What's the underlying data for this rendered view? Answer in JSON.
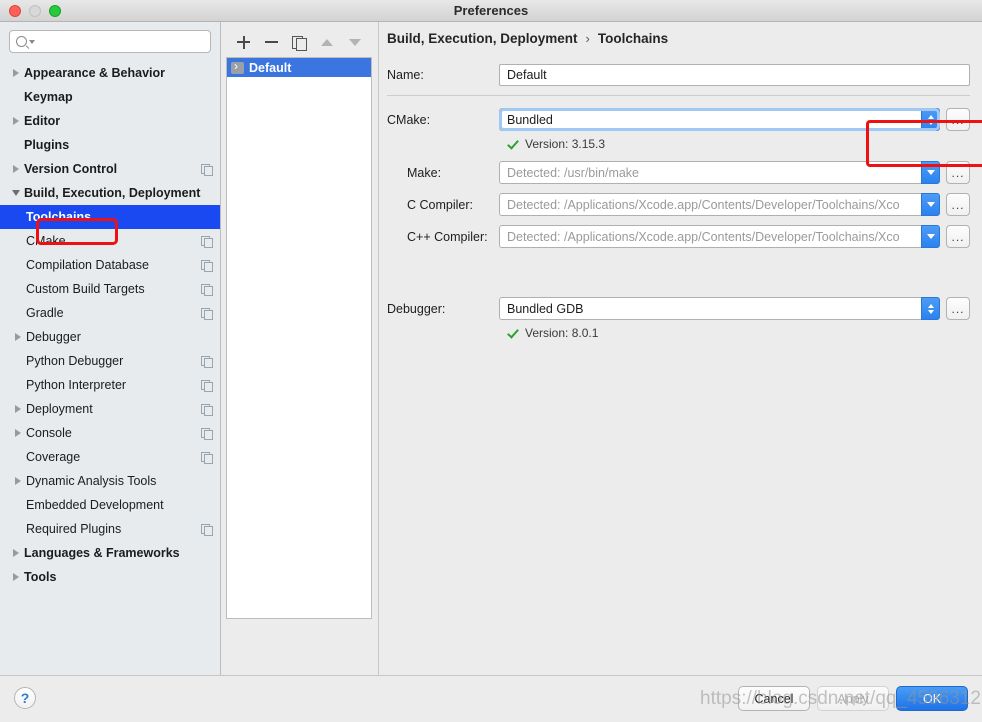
{
  "window": {
    "title": "Preferences",
    "traffic_lights": [
      "close-red",
      "minimize-gray",
      "zoom-green"
    ]
  },
  "sidebar": {
    "search": {
      "value": "",
      "placeholder": ""
    },
    "items": [
      {
        "label": "Appearance & Behavior",
        "level": 0,
        "twisty": "collapsed",
        "bold": true,
        "badge": false,
        "selected": false
      },
      {
        "label": "Keymap",
        "level": 0,
        "twisty": "none",
        "bold": true,
        "badge": false,
        "selected": false
      },
      {
        "label": "Editor",
        "level": 0,
        "twisty": "collapsed",
        "bold": true,
        "badge": false,
        "selected": false
      },
      {
        "label": "Plugins",
        "level": 0,
        "twisty": "none",
        "bold": true,
        "badge": false,
        "selected": false
      },
      {
        "label": "Version Control",
        "level": 0,
        "twisty": "collapsed",
        "bold": true,
        "badge": true,
        "selected": false
      },
      {
        "label": "Build, Execution, Deployment",
        "level": 0,
        "twisty": "expanded",
        "bold": true,
        "badge": false,
        "selected": false
      },
      {
        "label": "Toolchains",
        "level": 1,
        "twisty": "none",
        "bold": false,
        "badge": false,
        "selected": true
      },
      {
        "label": "CMake",
        "level": 1,
        "twisty": "none",
        "bold": false,
        "badge": true,
        "selected": false
      },
      {
        "label": "Compilation Database",
        "level": 1,
        "twisty": "none",
        "bold": false,
        "badge": true,
        "selected": false
      },
      {
        "label": "Custom Build Targets",
        "level": 1,
        "twisty": "none",
        "bold": false,
        "badge": true,
        "selected": false
      },
      {
        "label": "Gradle",
        "level": 1,
        "twisty": "none",
        "bold": false,
        "badge": true,
        "selected": false
      },
      {
        "label": "Debugger",
        "level": 1,
        "twisty": "collapsed",
        "bold": false,
        "badge": false,
        "selected": false
      },
      {
        "label": "Python Debugger",
        "level": 1,
        "twisty": "none",
        "bold": false,
        "badge": true,
        "selected": false
      },
      {
        "label": "Python Interpreter",
        "level": 1,
        "twisty": "none",
        "bold": false,
        "badge": true,
        "selected": false
      },
      {
        "label": "Deployment",
        "level": 1,
        "twisty": "collapsed",
        "bold": false,
        "badge": true,
        "selected": false
      },
      {
        "label": "Console",
        "level": 1,
        "twisty": "collapsed",
        "bold": false,
        "badge": true,
        "selected": false
      },
      {
        "label": "Coverage",
        "level": 1,
        "twisty": "none",
        "bold": false,
        "badge": true,
        "selected": false
      },
      {
        "label": "Dynamic Analysis Tools",
        "level": 1,
        "twisty": "collapsed",
        "bold": false,
        "badge": false,
        "selected": false
      },
      {
        "label": "Embedded Development",
        "level": 1,
        "twisty": "none",
        "bold": false,
        "badge": false,
        "selected": false
      },
      {
        "label": "Required Plugins",
        "level": 1,
        "twisty": "none",
        "bold": false,
        "badge": true,
        "selected": false
      },
      {
        "label": "Languages & Frameworks",
        "level": 0,
        "twisty": "collapsed",
        "bold": true,
        "badge": false,
        "selected": false
      },
      {
        "label": "Tools",
        "level": 0,
        "twisty": "collapsed",
        "bold": true,
        "badge": false,
        "selected": false
      }
    ]
  },
  "toolchain_list": {
    "toolbar": [
      {
        "icon": "plus-icon",
        "name": "add-toolchain-button",
        "enabled": true
      },
      {
        "icon": "minus-icon",
        "name": "remove-toolchain-button",
        "enabled": true
      },
      {
        "icon": "copy-icon",
        "name": "duplicate-toolchain-button",
        "enabled": true
      },
      {
        "icon": "arrow-up-icon",
        "name": "move-up-button",
        "enabled": false
      },
      {
        "icon": "arrow-down-icon",
        "name": "move-down-button",
        "enabled": false
      }
    ],
    "items": [
      {
        "label": "Default",
        "selected": true
      }
    ]
  },
  "breadcrumb": {
    "root": "Build, Execution, Deployment",
    "separator": "›",
    "leaf": "Toolchains"
  },
  "form": {
    "name": {
      "label": "Name:",
      "value": "Default"
    },
    "cmake": {
      "label": "CMake:",
      "value": "Bundled",
      "browse": "...",
      "version": "Version: 3.15.3",
      "highlighted": true,
      "focused": true
    },
    "make": {
      "label": "Make:",
      "value": "Detected: /usr/bin/make",
      "is_placeholder": true,
      "browse": "..."
    },
    "c_compiler": {
      "label": "C Compiler:",
      "value": "Detected: /Applications/Xcode.app/Contents/Developer/Toolchains/Xco",
      "is_placeholder": true,
      "browse": "..."
    },
    "cpp_compiler": {
      "label": "C++ Compiler:",
      "value": "Detected: /Applications/Xcode.app/Contents/Developer/Toolchains/Xco",
      "is_placeholder": true,
      "browse": "..."
    },
    "debugger": {
      "label": "Debugger:",
      "value": "Bundled GDB",
      "browse": "...",
      "version": "Version: 8.0.1"
    }
  },
  "footer": {
    "help": "?",
    "cancel": "Cancel",
    "apply": "Apply",
    "apply_enabled": false,
    "ok": "OK"
  },
  "overlay": {
    "watermark": "https://blog.csdn.net/qq_45963122",
    "highlight_color": "#ee1111"
  },
  "colors": {
    "selection_blue": "#1a49f2",
    "list_selection_blue": "#3b76e0",
    "primary_button": "#1d72e8",
    "sidebar_bg": "#e7ebee",
    "panel_bg": "#ececec",
    "success_green": "#2ca02c"
  }
}
